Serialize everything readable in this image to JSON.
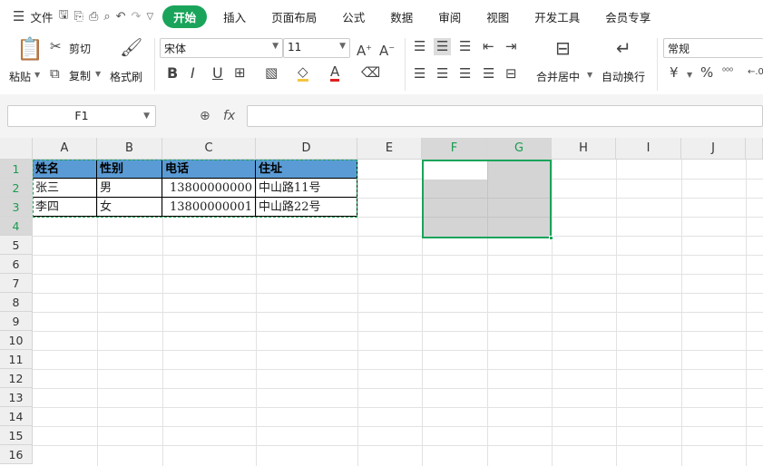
{
  "menubar": {
    "file": "文件",
    "tabs": [
      "开始",
      "插入",
      "页面布局",
      "公式",
      "数据",
      "审阅",
      "视图",
      "开发工具",
      "会员专享"
    ],
    "active_tab": "开始"
  },
  "ribbon": {
    "paste": "粘贴",
    "cut": "剪切",
    "copy": "复制",
    "format_painter": "格式刷",
    "font_name": "宋体",
    "font_size": "11",
    "bold": "B",
    "italic": "I",
    "underline": "U",
    "merge_center": "合并居中",
    "wrap_text": "自动换行",
    "number_format": "常规",
    "currency": "¥",
    "percent": "%"
  },
  "formula_bar": {
    "name_box": "F1",
    "fx_label": "fx",
    "formula": ""
  },
  "sheet": {
    "columns": [
      "A",
      "B",
      "C",
      "D",
      "E",
      "F",
      "G",
      "H",
      "I",
      "J"
    ],
    "rows": [
      "1",
      "2",
      "3",
      "4",
      "5",
      "6",
      "7",
      "8",
      "9",
      "10",
      "11",
      "12",
      "13",
      "14",
      "15",
      "16"
    ],
    "header_row": [
      "姓名",
      "性别",
      "电话",
      "住址"
    ],
    "data_rows": [
      [
        "张三",
        "男",
        "13800000000",
        "中山路11号"
      ],
      [
        "李四",
        "女",
        "13800000001",
        "中山路22号"
      ]
    ]
  },
  "colors": {
    "accent": "#1aa45b",
    "header_fill": "#5b9bd5"
  }
}
